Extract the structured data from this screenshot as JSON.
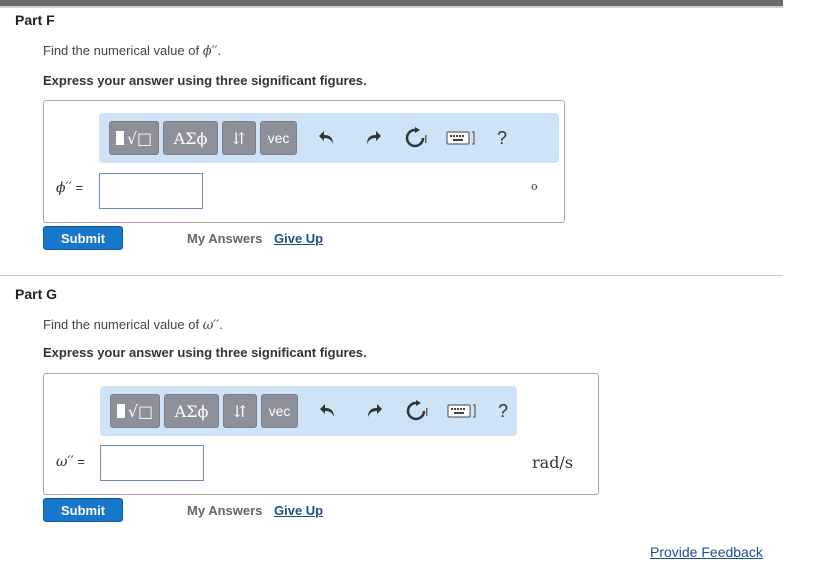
{
  "partF": {
    "title": "Part F",
    "question_prefix": "Find the numerical value of ",
    "question_var": "ϕ′′",
    "question_suffix": ".",
    "instruction": "Express your answer using three significant figures.",
    "var_label": "ϕ′′",
    "equals": "=",
    "input_value": "",
    "unit": "o",
    "submit": "Submit",
    "my_answers": "My Answers",
    "give_up": "Give Up"
  },
  "partG": {
    "title": "Part G",
    "question_prefix": "Find the numerical value of ",
    "question_var": "ω′′",
    "question_suffix": ".",
    "instruction": "Express your answer using three significant figures.",
    "var_label": "ω′′",
    "equals": "=",
    "input_value": "",
    "unit": "rad/s",
    "submit": "Submit",
    "my_answers": "My Answers",
    "give_up": "Give Up"
  },
  "toolbar": {
    "templates_label": "√□",
    "greek_label": "ΑΣϕ",
    "arrows_label": "⇵",
    "vec_label": "vec",
    "help_label": "?",
    "icons": [
      "templates-icon",
      "greek-icon",
      "subscript-arrows-icon",
      "vector-icon",
      "undo-icon",
      "redo-icon",
      "reset-icon",
      "keyboard-icon",
      "help-icon"
    ]
  },
  "footer": {
    "feedback": "Provide Feedback"
  },
  "colors": {
    "toolbar_bg": "#cfe3f7",
    "button_gray": "#8b9099",
    "submit_blue": "#1877c9",
    "link_blue": "#1d4f8c"
  }
}
